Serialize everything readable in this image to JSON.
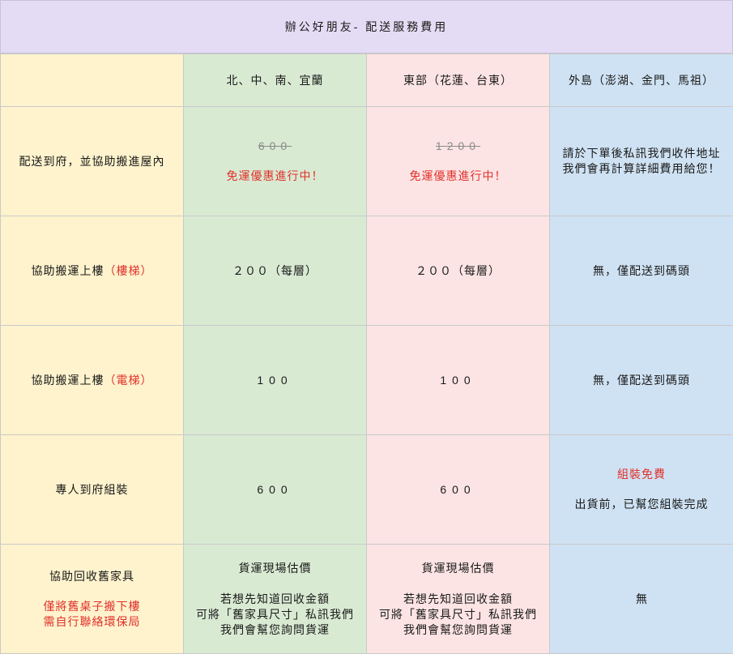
{
  "title": "辦公好朋友- 配送服務費用",
  "header": {
    "corner": "",
    "col_north": "北、中、南、宜蘭",
    "col_east": "東部（花蓮、台東）",
    "col_island": "外島（澎湖、金門、馬祖）"
  },
  "rows": {
    "delivery": {
      "label": "配送到府，並協助搬進屋內",
      "north_old_price": "600",
      "north_promo": "免運優惠進行中！",
      "east_old_price": "1200",
      "east_promo": "免運優惠進行中！",
      "island_line1": "請於下單後私訊我們收件地址",
      "island_line2": "我們會再計算詳細費用給您！"
    },
    "stairs": {
      "label_prefix": "協助搬運上樓",
      "label_highlight": "（樓梯）",
      "north": "２００（每層）",
      "east": "２００（每層）",
      "island": "無，僅配送到碼頭"
    },
    "elevator": {
      "label_prefix": "協助搬運上樓",
      "label_highlight": "（電梯）",
      "north": "100",
      "east": "100",
      "island": "無，僅配送到碼頭"
    },
    "assembly": {
      "label": "專人到府組裝",
      "north": "600",
      "east": "600",
      "island_highlight": "組裝免費",
      "island_note": "出貨前，已幫您組裝完成"
    },
    "recycle": {
      "label": "協助回收舊家具",
      "label_note_line1": "僅將舊桌子搬下樓",
      "label_note_line2": "需自行聯絡環保局",
      "north_head": "貨運現場估價",
      "north_line1": "若想先知道回收金額",
      "north_line2": "可將「舊家具尺寸」私訊我們",
      "north_line3": "我們會幫您詢問貨運",
      "east_head": "貨運現場估價",
      "east_line1": "若想先知道回收金額",
      "east_line2": "可將「舊家具尺寸」私訊我們",
      "east_line3": "我們會幫您詢問貨運",
      "island": "無"
    }
  },
  "colors": {
    "title_bg": "#e4dcf4",
    "label_col_bg": "#fff3cd",
    "north_col_bg": "#d9ead3",
    "east_col_bg": "#fde4e4",
    "island_col_bg": "#cfe2f3",
    "highlight_red": "#e0312b"
  }
}
